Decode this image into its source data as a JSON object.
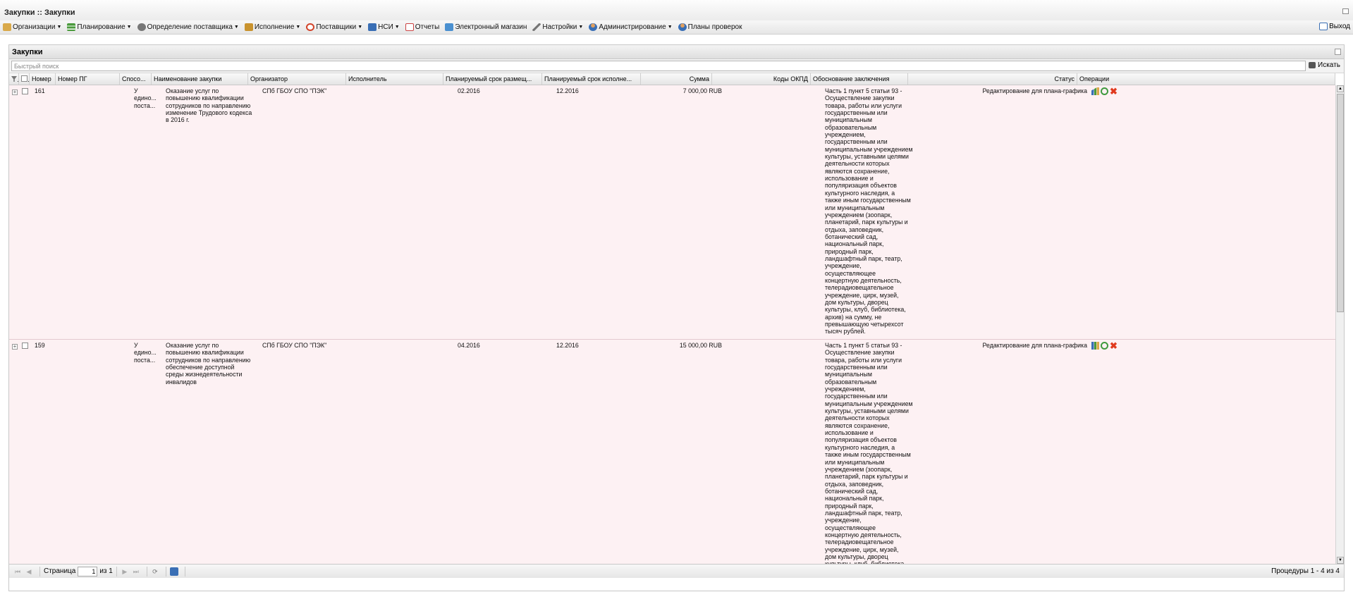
{
  "window": {
    "title": "Закупки :: Закупки"
  },
  "menu": [
    {
      "label": "Организации",
      "icon": "folder-icon",
      "caret": true
    },
    {
      "label": "Планирование",
      "icon": "list-icon",
      "caret": true
    },
    {
      "label": "Определение поставщика",
      "icon": "gear-icon",
      "caret": true
    },
    {
      "label": "Исполнение",
      "icon": "box-icon",
      "caret": true
    },
    {
      "label": "Поставщики",
      "icon": "clock-icon",
      "caret": true
    },
    {
      "label": "НСИ",
      "icon": "book-icon",
      "caret": true
    },
    {
      "label": "Отчеты",
      "icon": "report-icon",
      "caret": false
    },
    {
      "label": "Электронный магазин",
      "icon": "store-icon",
      "caret": false
    },
    {
      "label": "Настройки",
      "icon": "wrench-icon",
      "caret": true
    },
    {
      "label": "Администрирование",
      "icon": "user-icon",
      "caret": true
    },
    {
      "label": "Планы проверок",
      "icon": "user-icon",
      "caret": false
    }
  ],
  "logout_label": "Выход",
  "panel": {
    "title": "Закупки"
  },
  "search": {
    "placeholder": "Быстрый поиск",
    "button_label": "Искать"
  },
  "columns": {
    "number": "Номер",
    "pg_number": "Номер ПГ",
    "method": "Спосо...",
    "name": "Наименование закупки",
    "organizer": "Организатор",
    "executor": "Исполнитель",
    "placement": "Планируемый срок размещ...",
    "execution": "Планируемый срок исполне...",
    "sum": "Сумма",
    "okpd": "Коды ОКПД",
    "basis": "Обоснование заключения",
    "status": "Статус",
    "operations": "Операции"
  },
  "rows": [
    {
      "number": "161",
      "pg_number": "",
      "method": "У\nедино...\nпоста...",
      "name": "Оказание услуг по\nповышению квалификации\nсотрудников по направлению\nизменение Трудового кодекса\nв 2016 г.",
      "organizer": "СПб ГБОУ СПО \"ПЭК\"",
      "executor": "",
      "placement": "02.2016",
      "execution": "12.2016",
      "sum": "7 000,00 RUB",
      "okpd": "",
      "basis": "Часть 1 пункт 5 статьи 93 -\nОсуществление закупки\nтовара, работы или услуги\nгосударственным или\nмуниципальным\nобразовательным\nучреждением,\nгосударственным или\nмуниципальным учреждением\nкультуры, уставными целями\nдеятельности которых\nявляются сохранение,\nиспользование и\nпопуляризация объектов\nкультурного наследия, а\nтакже иным государственным\nили муниципальным\nучреждением (зоопарк,\nпланетарий, парк культуры и\nотдыха, заповедник,\nботанический сад,\nнациональный парк,\nприродный парк,\nландшафтный парк, театр,\nучреждение,\nосуществляющее\nконцертную деятельность,\nтелерадиовещательное\nучреждение, цирк, музей,\nдом культуры, дворец\nкультуры, клуб, библиотека,\nархив) на сумму, не\nпревышающую четырехсот\nтысяч рублей.",
      "status": "Редактирование для плана-графика"
    },
    {
      "number": "159",
      "pg_number": "",
      "method": "У\nедино...\nпоста...",
      "name": "Оказание услуг по\nповышению квалификации\nсотрудников по направлению\nобеспечение доступной\nсреды жизнедеятельности\nинвалидов",
      "organizer": "СПб ГБОУ СПО \"ПЭК\"",
      "executor": "",
      "placement": "04.2016",
      "execution": "12.2016",
      "sum": "15 000,00 RUB",
      "okpd": "",
      "basis": "Часть 1 пункт 5 статьи 93 -\nОсуществление закупки\nтовара, работы или услуги\nгосударственным или\nмуниципальным\nобразовательным\nучреждением,\nгосударственным или\nмуниципальным учреждением\nкультуры, уставными целями\nдеятельности которых\nявляются сохранение,\nиспользование и\nпопуляризация объектов\nкультурного наследия, а\nтакже иным государственным\nили муниципальным\nучреждением (зоопарк,\nпланетарий, парк культуры и\nотдыха, заповедник,\nботанический сад,\nнациональный парк,\nприродный парк,\nландшафтный парк, театр,\nучреждение,\nосуществляющее\nконцертную деятельность,\nтелерадиовещательное\nучреждение, цирк, музей,\nдом культуры, дворец\nкультуры, клуб, библиотека,",
      "status": "Редактирование для плана-графика"
    }
  ],
  "pager": {
    "page_label": "Страница",
    "page_value": "1",
    "of_label": "из 1",
    "info": "Процедуры 1 - 4 из 4"
  },
  "colors": {
    "row_bg": "#fdf1f3",
    "delete": "#e03a1e",
    "accent": "#3a6fb5"
  }
}
